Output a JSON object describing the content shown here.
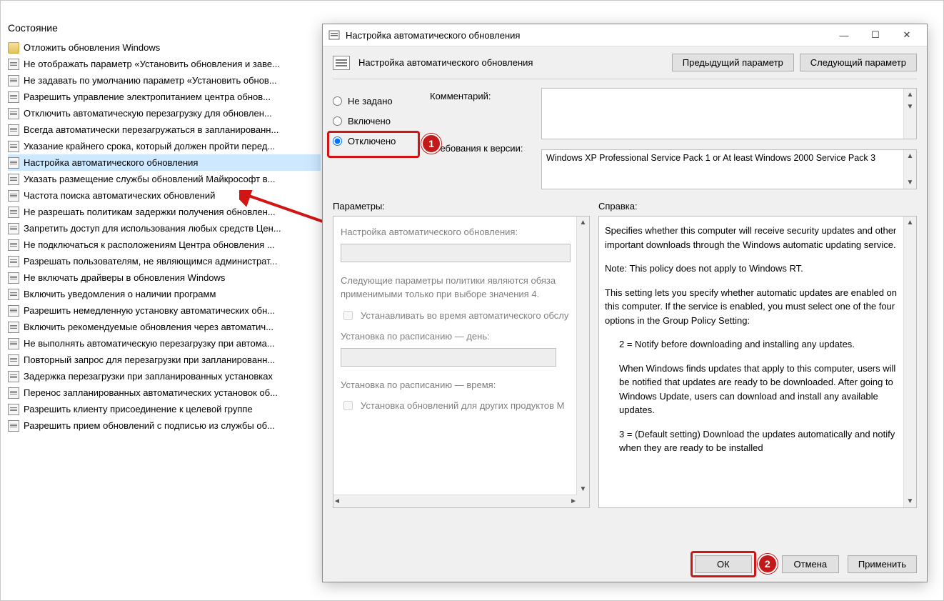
{
  "left": {
    "header": "Состояние",
    "items": [
      {
        "type": "folder",
        "label": "Отложить обновления Windows"
      },
      {
        "type": "policy",
        "label": "Не отображать параметр «Установить обновления и заве..."
      },
      {
        "type": "policy",
        "label": "Не задавать по умолчанию параметр «Установить обнов..."
      },
      {
        "type": "policy",
        "label": "Разрешить управление электропитанием центра обнов..."
      },
      {
        "type": "policy",
        "label": "Отключить автоматическую перезагрузку для обновлен..."
      },
      {
        "type": "policy",
        "label": "Всегда автоматически перезагружаться в запланированн..."
      },
      {
        "type": "policy",
        "label": "Указание крайнего срока, который должен пройти перед..."
      },
      {
        "type": "policy",
        "label": "Настройка автоматического обновления",
        "selected": true
      },
      {
        "type": "policy",
        "label": "Указать размещение службы обновлений Майкрософт в..."
      },
      {
        "type": "policy",
        "label": "Частота поиска автоматических обновлений"
      },
      {
        "type": "policy",
        "label": "Не разрешать политикам задержки получения обновлен..."
      },
      {
        "type": "policy",
        "label": "Запретить доступ для использования любых средств Цен..."
      },
      {
        "type": "policy",
        "label": "Не подключаться к расположениям Центра обновления ..."
      },
      {
        "type": "policy",
        "label": "Разрешать пользователям, не являющимся администрат..."
      },
      {
        "type": "policy",
        "label": "Не включать драйверы в обновления Windows"
      },
      {
        "type": "policy",
        "label": "Включить уведомления о наличии программ"
      },
      {
        "type": "policy",
        "label": "Разрешить немедленную установку автоматических обн..."
      },
      {
        "type": "policy",
        "label": "Включить рекомендуемые обновления через автоматич..."
      },
      {
        "type": "policy",
        "label": "Не выполнять автоматическую перезагрузку при автома..."
      },
      {
        "type": "policy",
        "label": "Повторный запрос для перезагрузки при запланированн..."
      },
      {
        "type": "policy",
        "label": "Задержка перезагрузки при запланированных установках"
      },
      {
        "type": "policy",
        "label": "Перенос запланированных автоматических установок об..."
      },
      {
        "type": "policy",
        "label": "Разрешить клиенту присоединение к целевой группе"
      },
      {
        "type": "policy",
        "label": "Разрешить прием обновлений с подписью из службы об..."
      }
    ]
  },
  "dialog": {
    "title": "Настройка автоматического обновления",
    "header_title": "Настройка автоматического обновления",
    "nav_prev": "Предыдущий параметр",
    "nav_next": "Следующий параметр",
    "radio_notset": "Не задано",
    "radio_enabled": "Включено",
    "radio_disabled": "Отключено",
    "comment_label": "Комментарий:",
    "req_label": "Требования к версии:",
    "req_text": "Windows XP Professional Service Pack 1 or At least Windows 2000 Service Pack 3",
    "params_title": "Параметры:",
    "help_title": "Справка:",
    "params": {
      "p1": "Настройка автоматического обновления:",
      "p2a": "Следующие параметры политики являются обяза",
      "p2b": "применимыми только при выборе значения 4.",
      "chk1": "Устанавливать во время автоматического обслу",
      "p3": "Установка по расписанию — день:",
      "p4": "Установка по расписанию — время:",
      "chk2": "Установка обновлений для других продуктов М"
    },
    "help": {
      "h1": "Specifies whether this computer will receive security updates and other important downloads through the Windows automatic updating service.",
      "h2": "Note: This policy does not apply to Windows RT.",
      "h3": "This setting lets you specify whether automatic updates are enabled on this computer. If the service is enabled, you must select one of the four options in the Group Policy Setting:",
      "h4": "2 = Notify before downloading and installing any updates.",
      "h5": "When Windows finds updates that apply to this computer, users will be notified that updates are ready to be downloaded. After going to Windows Update, users can download and install any available updates.",
      "h6": "3 = (Default setting) Download the updates automatically and notify when they are ready to be installed"
    },
    "ok": "ОК",
    "cancel": "Отмена",
    "apply": "Применить"
  },
  "annotations": {
    "step1": "1",
    "step2": "2"
  }
}
